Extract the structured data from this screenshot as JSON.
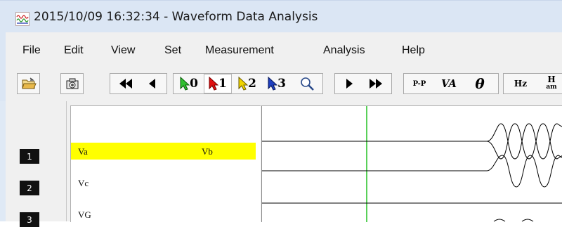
{
  "window": {
    "title": "2015/10/09 16:32:34  - Waveform Data Analysis"
  },
  "menu": [
    "File",
    "Edit",
    "View",
    "Set",
    "Measurement",
    "Analysis",
    "Help"
  ],
  "toolbar": {
    "cursor_labels": [
      "0",
      "1",
      "2",
      "3"
    ],
    "pp_label": "P-P",
    "va_label": "VA",
    "theta_label": "θ",
    "hz_label": "Hz",
    "ham_label": "H",
    "ham_sub": "am",
    "colors": {
      "cursor0": "#2fbf2f",
      "cursor1": "#e01010",
      "cursor2": "#e6c800",
      "cursor3": "#1f3fbf"
    }
  },
  "channels": [
    {
      "number": "1",
      "left_name": "Va",
      "right_name": "Vb",
      "selected": true
    },
    {
      "number": "2",
      "left_name": "Vc",
      "right_name": "",
      "selected": false
    },
    {
      "number": "3",
      "left_name": "VG",
      "right_name": "",
      "selected": false
    }
  ],
  "colors": {
    "selection": "#ffff00",
    "cursor_line": "#22c022",
    "title_bg": "#dbe6f4"
  }
}
